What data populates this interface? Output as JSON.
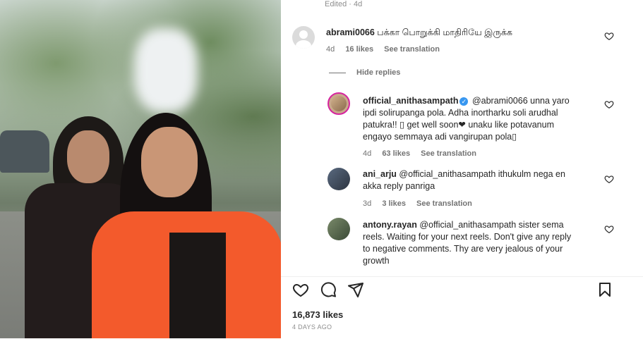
{
  "post": {
    "edited_label": "Edited · 4d",
    "likes": "16,873 likes",
    "time_ago": "4 DAYS AGO"
  },
  "comments": [
    {
      "username": "abrami0066",
      "text": "பக்கா பொறுக்கி மாதிரியே இருக்க",
      "age": "4d",
      "likes": "16 likes",
      "translate": "See translation"
    }
  ],
  "hide_replies_label": "Hide replies",
  "replies": [
    {
      "username": "official_anithasampath",
      "verified": true,
      "mention": "@abrami0066",
      "text_line1": "unna yaro",
      "text_line2": "ipdi solirupanga pola. Adha inortharku soli arudhal",
      "text_line3": "patukra!! ▯ get well soon❤ unaku like potavanum",
      "text_line4": "engayo semmaya adi vangirupan pola▯",
      "age": "4d",
      "likes": "63 likes",
      "translate": "See translation"
    },
    {
      "username": "ani_arju",
      "text_line1": "@official_anithasampath ithukulm nega en",
      "text_line2": "akka reply panriga",
      "age": "3d",
      "likes": "3 likes",
      "translate": "See translation"
    },
    {
      "username": "antony.rayan",
      "text_line1": "@official_anithasampath sister sema",
      "text_line2": "reels. Waiting for your next reels. Don't give any reply",
      "text_line3": "to negative comments. Thy are very jealous of your",
      "text_line4": "growth"
    }
  ],
  "icons": {
    "like": "heart-icon",
    "comment": "comment-icon",
    "share": "share-icon",
    "save": "bookmark-icon"
  }
}
